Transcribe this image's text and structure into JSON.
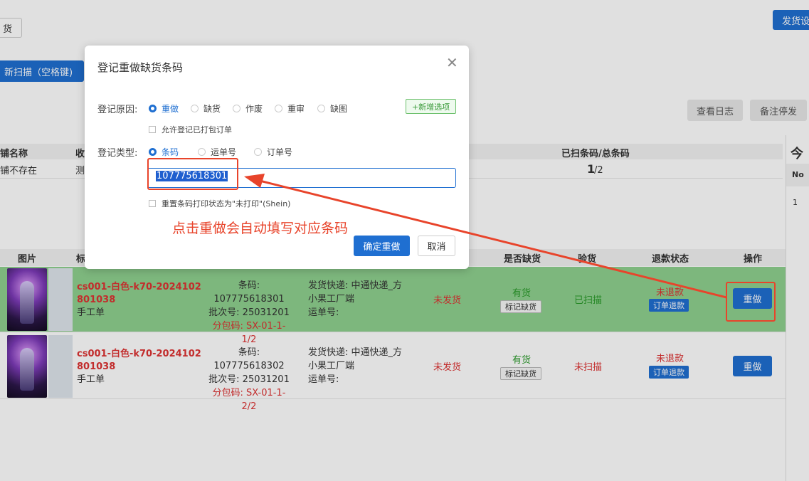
{
  "toolbar": {
    "ship_btn_partial": "货",
    "rescan_btn_partial": "新扫描（空格键)",
    "ship_settings_partial": "发货设",
    "view_log": "查看日志",
    "note_stop": "备注停发"
  },
  "summary": {
    "headers": [
      "铺名称",
      "收",
      "已扫条码/总条码"
    ],
    "row": [
      "铺不存在",
      "测"
    ],
    "scanned": "1",
    "total": "/2"
  },
  "side_panel": {
    "title": "今日",
    "no_label": "No",
    "row1": "1"
  },
  "table": {
    "headers": [
      "图片",
      "标",
      "是否缺货",
      "验货",
      "退款状态",
      "操作"
    ],
    "rows": [
      {
        "product_line1": "cs001-白色-k70-2024102",
        "product_line2": "801038",
        "product_sub": "手工单",
        "barcode": "条码: 107775618301",
        "batch": "批次号: 25031201",
        "package": "分包码: SX-01-1-1/2",
        "courier": "发货快递: 中通快递_方",
        "factory": "小果工厂端",
        "waybill": "运单号:",
        "ship_status": "未发货",
        "stock": "有货",
        "mark_short": "标记缺货",
        "inspect": "已扫描",
        "refund": "未退款",
        "refund_btn": "订单退款",
        "redo": "重做"
      },
      {
        "product_line1": "cs001-白色-k70-2024102",
        "product_line2": "801038",
        "product_sub": "手工单",
        "barcode": "条码: 107775618302",
        "batch": "批次号: 25031201",
        "package": "分包码: SX-01-1-2/2",
        "courier": "发货快递: 中通快递_方",
        "factory": "小果工厂端",
        "waybill": "运单号:",
        "ship_status": "未发货",
        "stock": "有货",
        "mark_short": "标记缺货",
        "inspect": "未扫描",
        "refund": "未退款",
        "refund_btn": "订单退款",
        "redo": "重做"
      }
    ]
  },
  "modal": {
    "title": "登记重做缺货条码",
    "reason_label": "登记原因:",
    "reasons": [
      "重做",
      "缺货",
      "作废",
      "重审",
      "缺图"
    ],
    "add_option": "+新增选项",
    "allow_packed": "允许登记已打包订单",
    "type_label": "登记类型:",
    "types": [
      "条码",
      "运单号",
      "订单号"
    ],
    "barcode_value": "107775618301",
    "reset_print": "重置条码打印状态为\"未打印\"(Shein)",
    "confirm": "确定重做",
    "cancel": "取消"
  },
  "annotation": {
    "text": "点击重做会自动填写对应条码",
    "color": "#e8442b"
  }
}
